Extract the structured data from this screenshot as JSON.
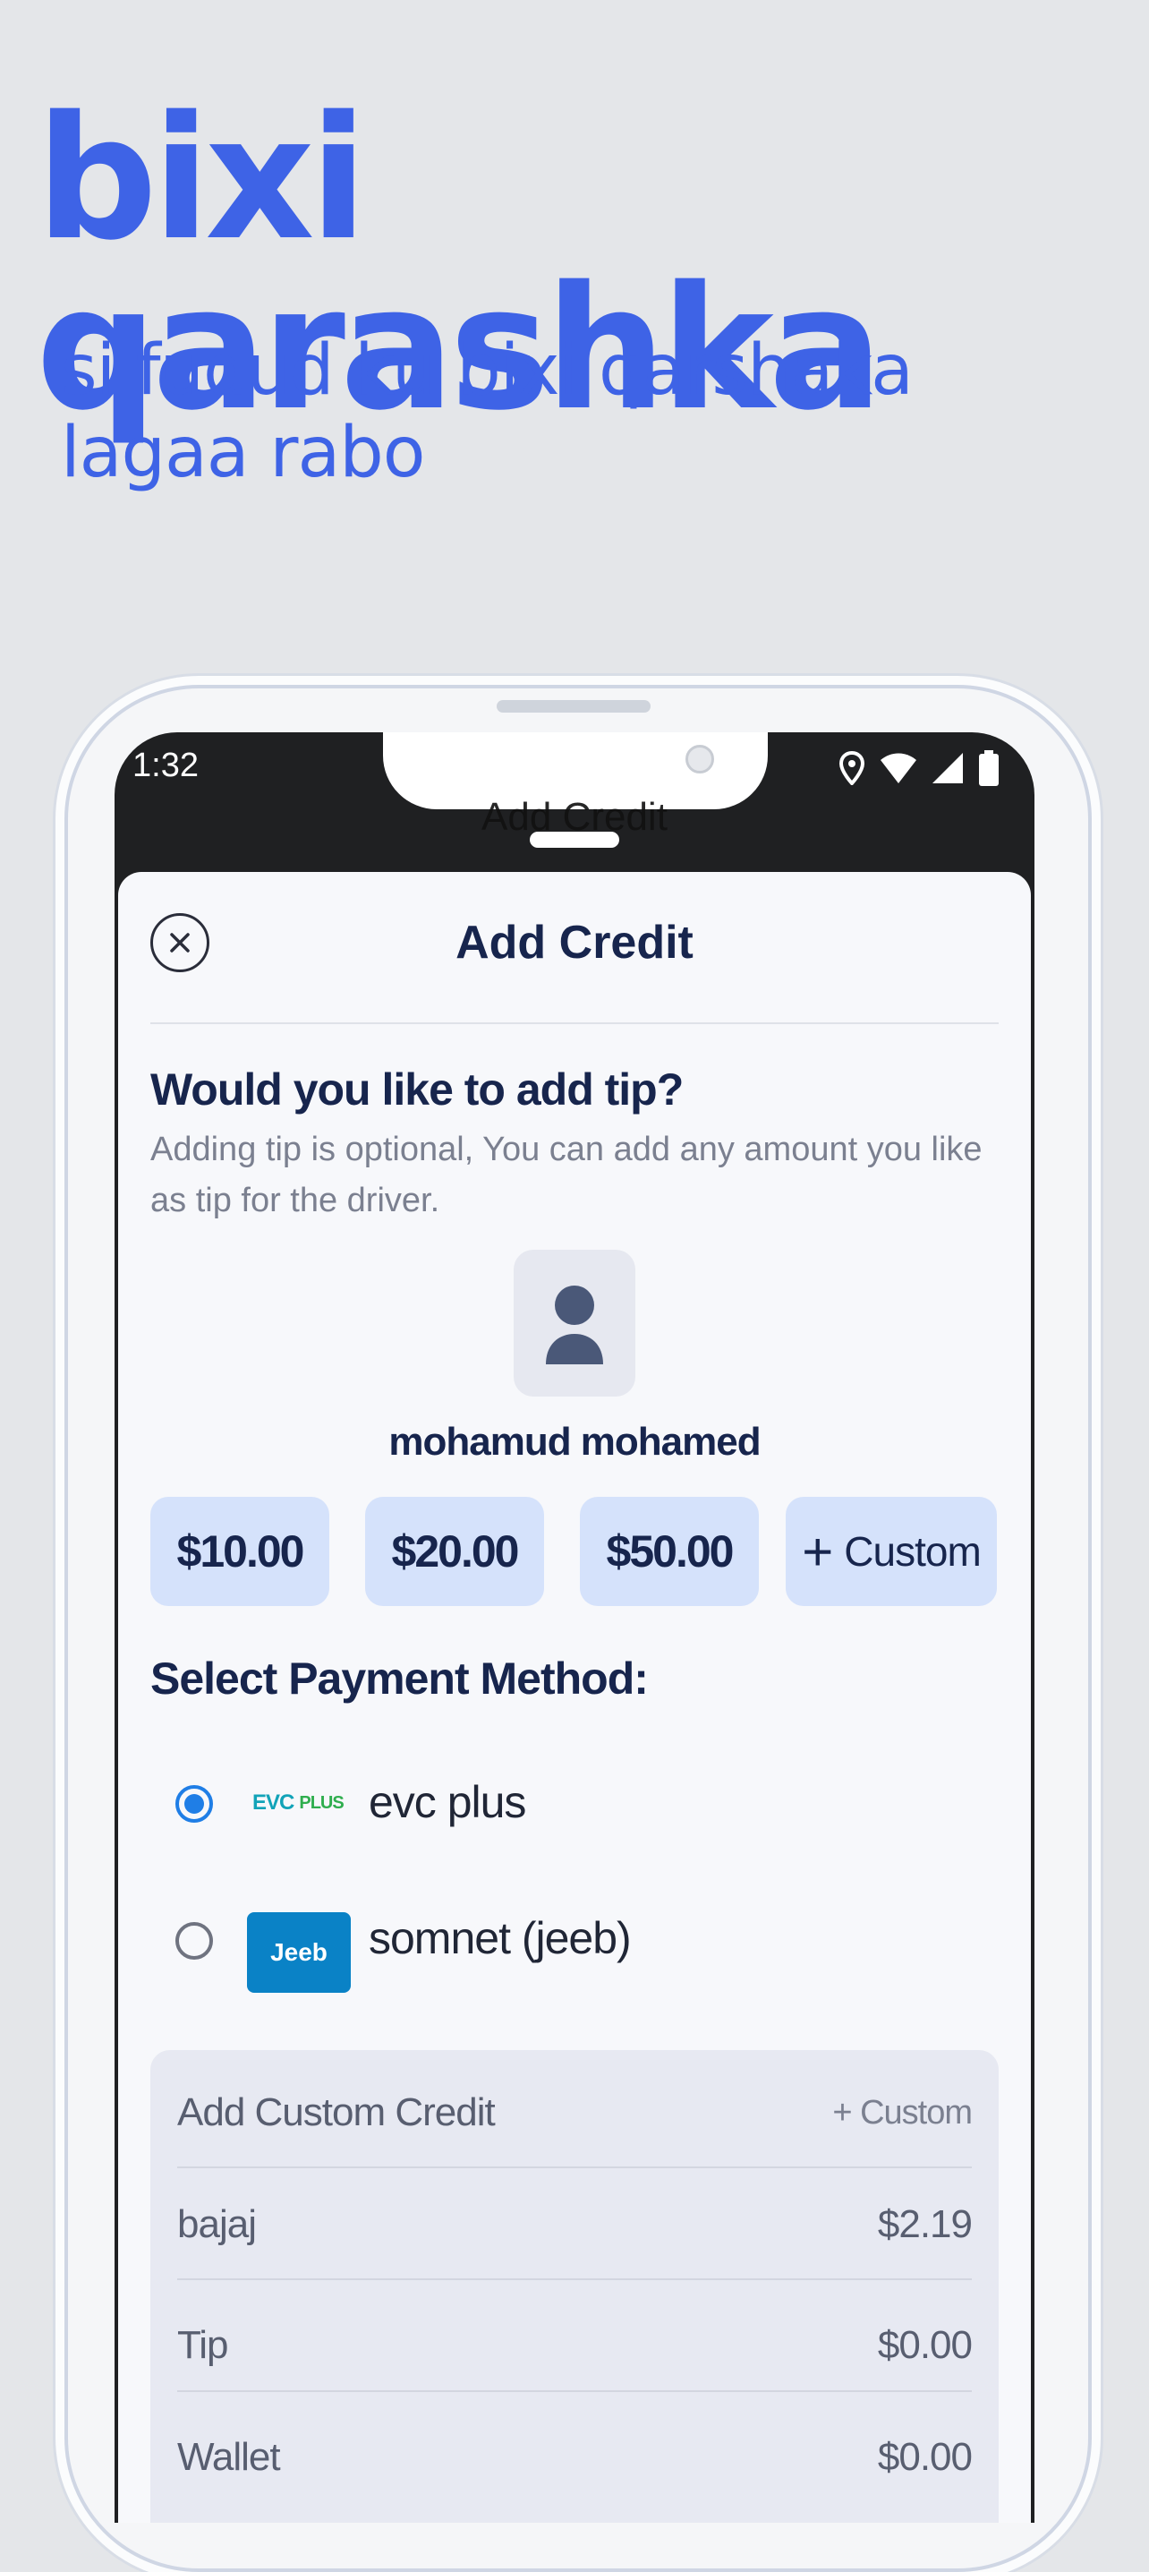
{
  "promo": {
    "title": "bixi qarashka",
    "subtitle": "si fudud ku bixi qarshaka lagaa rabo"
  },
  "status_bar": {
    "time": "1:32",
    "icons": [
      "location-icon",
      "wifi-icon",
      "signal-icon",
      "battery-icon"
    ]
  },
  "background_screen": {
    "title": "Add Credit"
  },
  "sheet": {
    "title": "Add Credit",
    "close_icon": "close-icon",
    "tip_heading": "Would you like to add tip?",
    "tip_description": "Adding tip is optional, You can add any amount you like as tip for the driver.",
    "driver": {
      "name": "mohamud mohamed",
      "avatar_icon": "person-icon"
    },
    "tip_options": [
      "$10.00",
      "$20.00",
      "$50.00"
    ],
    "custom_option": {
      "plus": "+",
      "label": "Custom"
    },
    "payment_heading": "Select Payment Method:",
    "payment_methods": [
      {
        "label": "evc plus",
        "logo_text": "EVC",
        "logo_text2": "PLUS",
        "selected": true
      },
      {
        "label": "somnet (jeeb)",
        "logo_text": "Jeeb",
        "selected": false
      }
    ],
    "summary": {
      "custom_credit": {
        "label": "Add Custom Credit",
        "action": "+ Custom"
      },
      "rows": [
        {
          "label": "bajaj",
          "value": "$2.19"
        },
        {
          "label": "Tip",
          "value": "$0.00"
        },
        {
          "label": "Wallet",
          "value": "$0.00"
        }
      ]
    }
  },
  "colors": {
    "promo_blue": "#3e63e6",
    "heading_navy": "#17254d",
    "chip_blue": "#d5e2fb",
    "radio_blue": "#1f7ee6",
    "jeeb_blue": "#0a82c6"
  }
}
